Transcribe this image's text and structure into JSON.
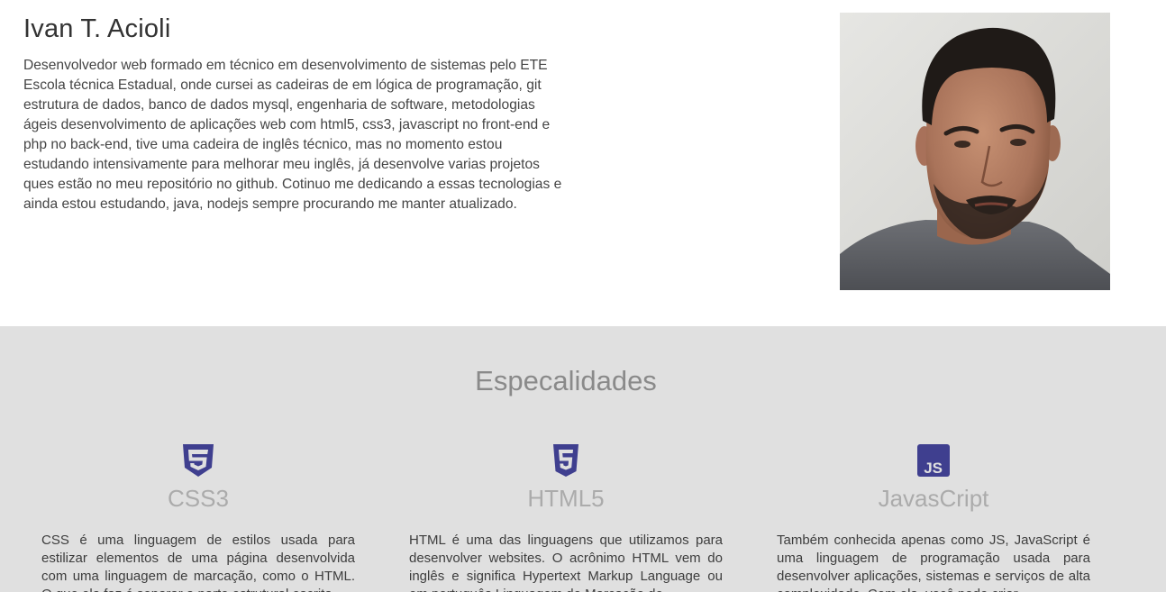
{
  "profile": {
    "name": "Ivan T. Acioli",
    "bio": "Desenvolvedor web formado em técnico em desenvolvimento de sistemas pelo ETE Escola técnica Estadual, onde cursei as cadeiras de em lógica de programação, git estrutura de dados, banco de dados mysql, engenharia de software, metodologias ágeis desenvolvimento de aplicações web com html5, css3, javascript no front-end e php no back-end, tive uma cadeira de inglês técnico, mas no momento estou estudando intensivamente para melhorar meu inglês, já desenvolve varias projetos ques estão no meu repositório no github. Cotinuo me dedicando a essas tecnologias e ainda estou estudando, java, nodejs sempre procurando me manter atualizado.",
    "photo": "profile-photo"
  },
  "skills": {
    "title": "Especalidades",
    "items": [
      {
        "icon": "css3-icon",
        "name": "CSS3",
        "description": "CSS é uma linguagem de estilos usada para estilizar elementos de uma página desenvolvida com uma linguagem de marcação, como o HTML. O que ela faz é separar a parte estrutural escrita,"
      },
      {
        "icon": "html5-icon",
        "name": "HTML5",
        "description": "HTML é uma das linguagens que utilizamos para desenvolver websites. O acrônimo HTML vem do inglês e significa Hypertext Markup Language ou em português Linguagem de Marcação de"
      },
      {
        "icon": "javascript-icon",
        "name": "JavasCript",
        "js_badge": "JS",
        "description": "Também conhecida apenas como JS, JavaScript é uma linguagem de programação usada para desenvolver aplicações, sistemas e serviços de alta complexidade. Com ela, você pode criar"
      }
    ]
  },
  "colors": {
    "icon": "#3f3f8f",
    "section_bg": "#e0e0e0",
    "title": "#8a8a8a",
    "skill_name": "#ababab"
  }
}
